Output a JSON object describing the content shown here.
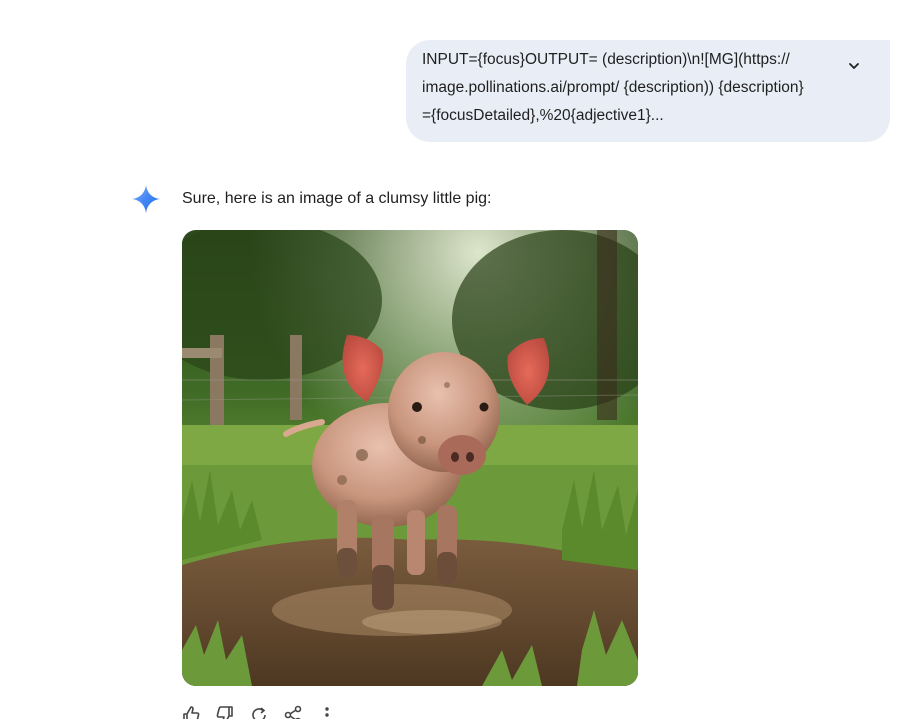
{
  "conversation": {
    "user_prompt": {
      "text": "INPUT={focus}OUTPUT= (description)\\n![MG](https://\nimage.pollinations.ai/prompt/ {description)) {description}\n={focusDetailed},%20{adjective1}...",
      "expand_icon": "chevron-down-icon"
    },
    "response": {
      "avatar_icon": "gemini-spark-icon",
      "text": "Sure, here is an image of a clumsy little pig:",
      "image_subject": "pig standing in mud on grass with wooden fence background",
      "actions": [
        {
          "icon": "thumbs-up-icon"
        },
        {
          "icon": "thumbs-down-icon"
        },
        {
          "icon": "regenerate-icon"
        },
        {
          "icon": "share-icon"
        },
        {
          "icon": "more-vert-icon"
        }
      ]
    }
  },
  "colors": {
    "user_bubble": "#e9eef6",
    "text": "#1f1f1f",
    "spark_blue": "#4285f4"
  }
}
